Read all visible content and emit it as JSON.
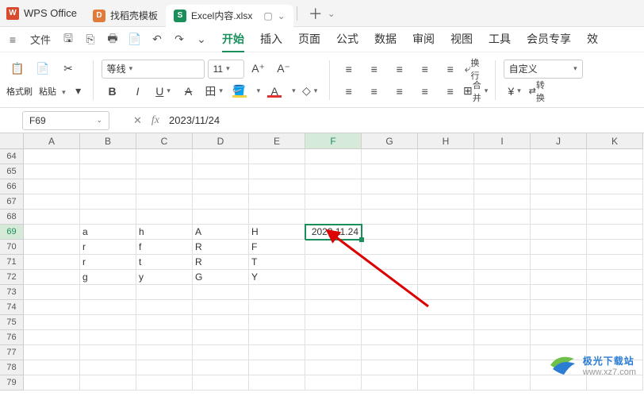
{
  "app": {
    "name": "WPS Office"
  },
  "tabs": [
    {
      "label": "找稻壳模板",
      "iconColor": "#e07b3c",
      "iconText": "D"
    },
    {
      "label": "Excel内容.xlsx",
      "iconColor": "#1a8f5c",
      "iconText": "S",
      "active": true
    }
  ],
  "menubar": {
    "hamburger": "≡",
    "file": "文件",
    "tabs": [
      "开始",
      "插入",
      "页面",
      "公式",
      "数据",
      "审阅",
      "视图",
      "工具",
      "会员专享",
      "效"
    ]
  },
  "ribbon": {
    "format_painter": "格式刷",
    "paste": "粘贴",
    "font_name": "等线",
    "font_size": "11",
    "wrap": "换行",
    "merge": "合并",
    "number_format": "自定义",
    "convert": "转换"
  },
  "formula_bar": {
    "cell_ref": "F69",
    "formula": "2023/11/24"
  },
  "columns": [
    "A",
    "B",
    "C",
    "D",
    "E",
    "F",
    "G",
    "H",
    "I",
    "J",
    "K"
  ],
  "active_col_index": 5,
  "row_start": 64,
  "row_end": 79,
  "active_row": 69,
  "cells": {
    "69": {
      "B": "a",
      "C": "h",
      "D": "A",
      "E": "H",
      "F": "2023.11.24"
    },
    "70": {
      "B": "r",
      "C": "f",
      "D": "R",
      "E": "F"
    },
    "71": {
      "B": "r",
      "C": "t",
      "D": "R",
      "E": "T"
    },
    "72": {
      "B": "g",
      "C": "y",
      "D": "G",
      "E": "Y"
    }
  },
  "watermark": {
    "main": "极光下载站",
    "sub": "www.xz7.com"
  }
}
